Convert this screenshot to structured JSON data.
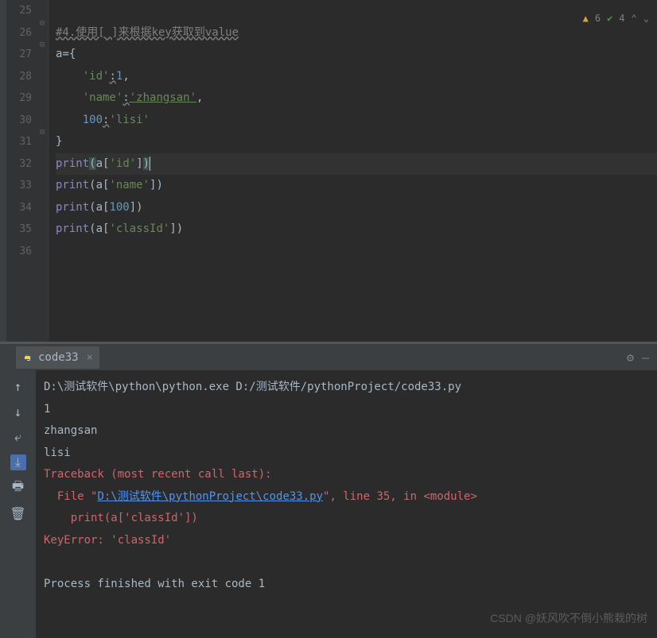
{
  "lines": {
    "start": 25,
    "end": 36
  },
  "code": {
    "l26_comment": "#4.使用[ ]来根据key获取到value",
    "l27_a": "a",
    "l27_eq": "=",
    "l27_brace": "{",
    "l28_key": "'id'",
    "l28_colon": ":",
    "l28_val": "1",
    "l28_comma": ",",
    "l29_key": "'name'",
    "l29_colon": ":",
    "l29_val": "'zhangsan'",
    "l29_comma": ",",
    "l30_key": "100",
    "l30_colon": ":",
    "l30_val": "'lisi'",
    "l31_brace": "}",
    "l32_func": "print",
    "l32_open": "(",
    "l32_a": "a",
    "l32_br1": "[",
    "l32_key": "'id'",
    "l32_br2": "]",
    "l32_close": ")",
    "l33_func": "print",
    "l33_rest_a": "(a[",
    "l33_key": "'name'",
    "l33_rest_b": "])",
    "l34_func": "print",
    "l34_rest_a": "(a[",
    "l34_key": "100",
    "l34_rest_b": "])",
    "l35_func": "print",
    "l35_rest_a": "(a[",
    "l35_key": "'classId'",
    "l35_rest_b": "])"
  },
  "indicators": {
    "warnings": "6",
    "checks": "4"
  },
  "tab": {
    "name": "code33"
  },
  "console": {
    "cmd": "D:\\测试软件\\python\\python.exe D:/测试软件/pythonProject/code33.py",
    "out1": "1",
    "out2": "zhangsan",
    "out3": "lisi",
    "err1": "Traceback (most recent call last):",
    "err2a": "  File \"",
    "err2_link": "D:\\测试软件\\pythonProject\\code33.py",
    "err2b": "\", line 35, in <module>",
    "err3": "    print(a['classId'])",
    "err4": "KeyError: 'classId'",
    "exit": "Process finished with exit code 1"
  },
  "watermark": "CSDN @妖风吹不倒小熊栽的树"
}
